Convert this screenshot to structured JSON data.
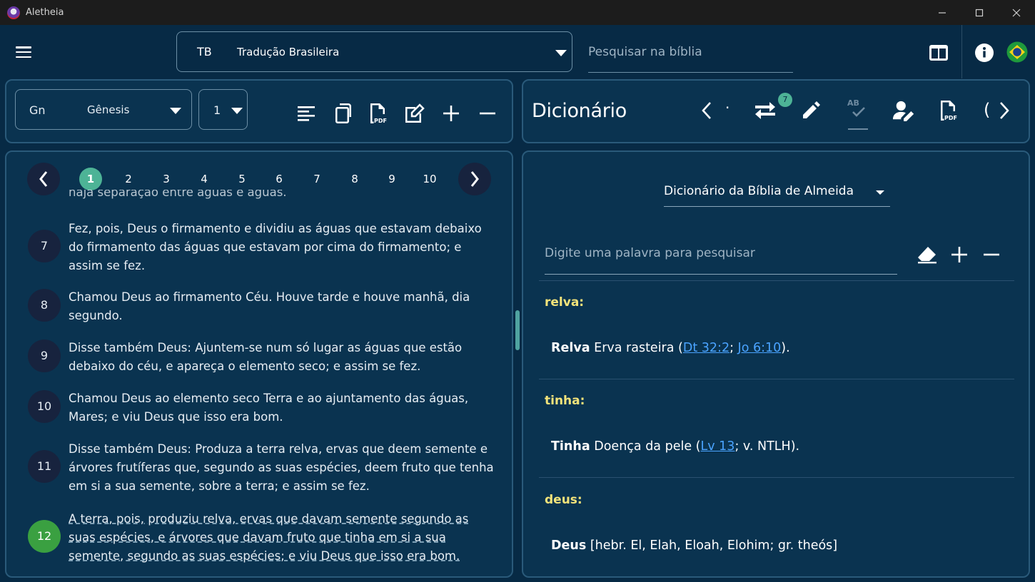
{
  "window": {
    "title": "Aletheia",
    "controls": [
      "minimize-icon",
      "maximize-icon",
      "close-icon"
    ]
  },
  "appbar": {
    "version_abbr": "TB",
    "version_name": "Tradução Brasileira",
    "search_placeholder": "Pesquisar na bíblia",
    "icons": [
      "menu-icon",
      "split-view-icon",
      "info-icon",
      "brazil-flag-icon"
    ]
  },
  "reader": {
    "book_abbr": "Gn",
    "book_name": "Gênesis",
    "chapter": "1",
    "toolbar_icons": [
      "align-icon",
      "copy-icon",
      "pdf-icon",
      "edit-note-icon",
      "plus-icon",
      "minus-icon"
    ],
    "pager": {
      "active": "1",
      "pages": [
        "1",
        "2",
        "3",
        "4",
        "5",
        "6",
        "7",
        "8",
        "9",
        "10"
      ]
    },
    "partial_text": "haja separação entre águas e águas.",
    "verses": [
      {
        "num": "7",
        "text": "Fez, pois, Deus o firmamento e dividiu as águas que estavam debaixo do firmamento das águas que estavam por cima do firmamento; e assim se fez."
      },
      {
        "num": "8",
        "text": "Chamou Deus ao firmamento Céu. Houve tarde e houve manhã, dia segundo."
      },
      {
        "num": "9",
        "text": "Disse também Deus: Ajuntem-se num só lugar as águas que estão debaixo do céu, e apareça o elemento seco; e assim se fez."
      },
      {
        "num": "10",
        "text": "Chamou Deus ao elemento seco Terra e ao ajuntamento das águas, Mares; e viu Deus que isso era bom."
      },
      {
        "num": "11",
        "text": "Disse também Deus: Produza a terra relva, ervas que deem semente e árvores frutíferas que, segundo as suas espécies, deem fruto que tenha em si a sua semente, sobre a terra; e assim se fez."
      },
      {
        "num": "12",
        "text": "A terra, pois, produziu relva, ervas que davam semente segundo as suas espécies, e árvores que davam fruto que tinha em si a sua semente, segundo as suas espécies; e viu Deus que isso era bom."
      }
    ]
  },
  "dictionary": {
    "title": "Dicionário",
    "badge_count": "7",
    "dot": "·",
    "bracket_label": "(",
    "source": "Dicionário da Bíblia de Almeida",
    "search_placeholder": "Digite uma palavra para pesquisar",
    "entries": [
      {
        "word": "relva:",
        "head": "Relva",
        "body": "Erva rasteira (",
        "link1": "Dt 32:2",
        "sep": "; ",
        "link2": "Jo 6:10",
        "tail": ")."
      },
      {
        "word": "tinha:",
        "head": "Tinha",
        "body": "Doença da pele (",
        "link1": "Lv 13",
        "sep": "",
        "link2": "",
        "tail": "; v. NTLH)."
      },
      {
        "word": "deus:",
        "head": "Deus",
        "body": "[hebr. El, Elah, Eloah, Elohim; gr. theós]",
        "link1": "",
        "sep": "",
        "link2": "",
        "tail": ""
      }
    ]
  },
  "colors": {
    "background": "#072a45",
    "panel": "#0a3350",
    "accent_active_page": "#4db396",
    "highlight_verse": "#3aa041",
    "entry_word": "#f3e37a",
    "link": "#4aa3ff"
  }
}
